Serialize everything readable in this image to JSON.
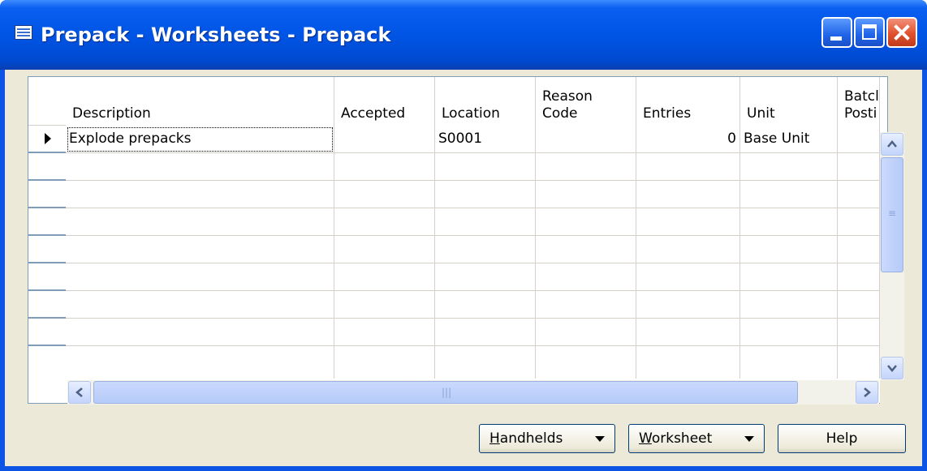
{
  "window": {
    "title": "Prepack - Worksheets - Prepack",
    "icon": "table-icon",
    "controls": [
      "minimize-icon",
      "maximize-icon",
      "close-icon"
    ]
  },
  "grid": {
    "columns": [
      {
        "key": "description",
        "label": "Description"
      },
      {
        "key": "accepted",
        "label": "Accepted"
      },
      {
        "key": "location",
        "label": "Location"
      },
      {
        "key": "reason_code",
        "label": "Reason\nCode"
      },
      {
        "key": "entries",
        "label": "Entries"
      },
      {
        "key": "unit",
        "label": "Unit"
      },
      {
        "key": "batch_posting",
        "label": "Batcl\nPosti"
      }
    ],
    "rows": [
      {
        "description": "Explode prepacks",
        "accepted": "",
        "location": "S0001",
        "reason_code": "",
        "entries": "0",
        "unit": "Base Unit",
        "batch_posting": ""
      }
    ]
  },
  "buttons": {
    "handhelds": {
      "first": "H",
      "rest": "andhelds"
    },
    "worksheet": {
      "first": "W",
      "rest": "orksheet"
    },
    "help": "Help"
  },
  "colors": {
    "titlebar": "#0055e5",
    "close_button": "#e0512e",
    "dialog_face": "#ece9d8"
  }
}
